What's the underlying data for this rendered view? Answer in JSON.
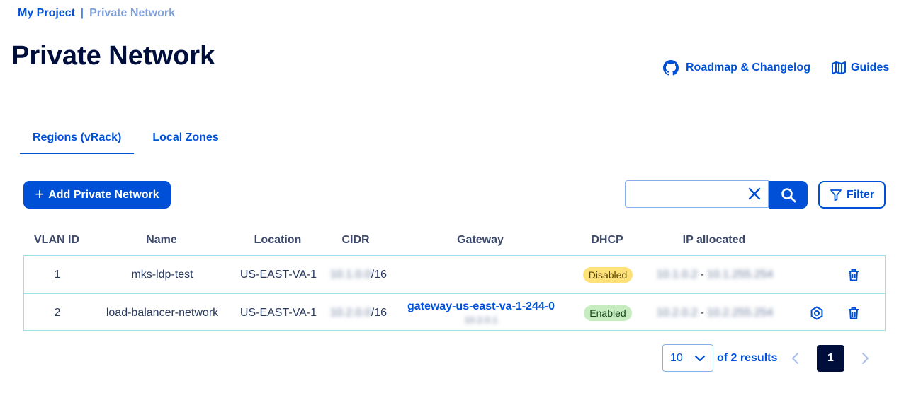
{
  "breadcrumb": {
    "project": "My Project",
    "separator": "|",
    "current": "Private Network"
  },
  "page": {
    "title": "Private Network"
  },
  "links": {
    "roadmap": "Roadmap & Changelog",
    "guides": "Guides"
  },
  "tabs": [
    {
      "label": "Regions (vRack)",
      "active": true
    },
    {
      "label": "Local Zones",
      "active": false
    }
  ],
  "toolbar": {
    "add_label": "Add Private Network",
    "add_icon": "plus-icon",
    "search_value": "",
    "filter_label": "Filter"
  },
  "table": {
    "headers": [
      "VLAN ID",
      "Name",
      "Location",
      "CIDR",
      "Gateway",
      "DHCP",
      "IP allocated"
    ],
    "rows": [
      {
        "vlan_id": "1",
        "name": "mks-ldp-test",
        "location": "US-EAST-VA-1",
        "cidr_prefix": "10.1.0.0",
        "cidr_suffix": "/16",
        "gateway_name": "",
        "gateway_ip": "",
        "dhcp": "Disabled",
        "ip_start": "10.1.0.2",
        "ip_separator": "-",
        "ip_end": "10.1.255.254"
      },
      {
        "vlan_id": "2",
        "name": "load-balancer-network",
        "location": "US-EAST-VA-1",
        "cidr_prefix": "10.2.0.0",
        "cidr_suffix": "/16",
        "gateway_name": "gateway-us-east-va-1-244-0",
        "gateway_ip": "10.2.0.1",
        "dhcp": "Enabled",
        "ip_start": "10.2.0.2",
        "ip_separator": "-",
        "ip_end": "10.2.255.254"
      }
    ]
  },
  "pagination": {
    "page_size": "10",
    "results_text": "of 2 results",
    "current_page": "1"
  },
  "colors": {
    "primary": "#0050d7",
    "title": "#000e3c",
    "disabled_badge": "#ffe17a",
    "enabled_badge": "#c6ecc0",
    "table_border": "#99e1ea"
  }
}
